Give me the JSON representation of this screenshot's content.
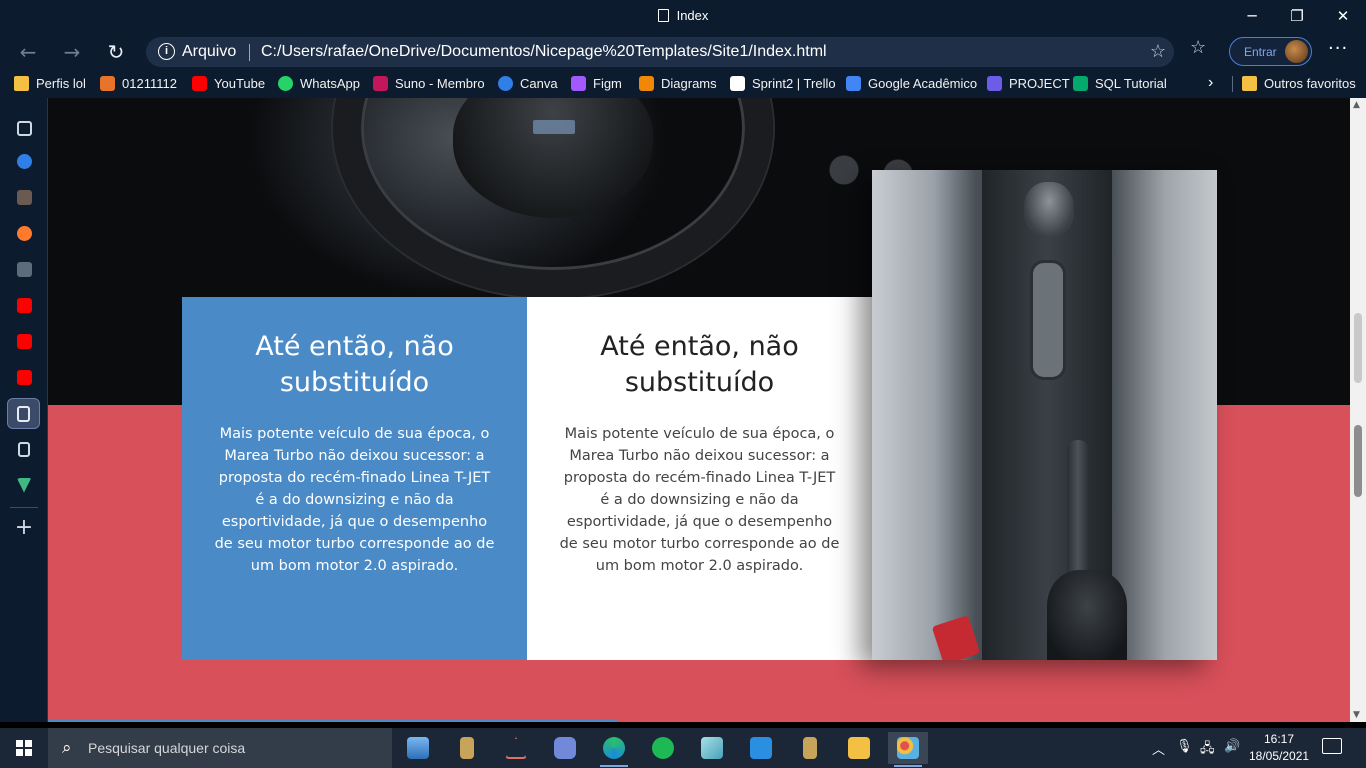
{
  "window": {
    "tab_title": "Index",
    "minimize": "─",
    "restore": "❐",
    "close": "✕"
  },
  "nav": {
    "back": "←",
    "forward": "→",
    "reload": "↻"
  },
  "address": {
    "site_label": "Arquivo",
    "url": "C:/Users/rafae/OneDrive/Documentos/Nicepage%20Templates/Site1/Index.html",
    "favorite_icon": "star-add-icon"
  },
  "profile": {
    "signin_label": "Entrar"
  },
  "bookmarks": {
    "items": [
      {
        "label": "Perfis lol",
        "color": "#f4c044"
      },
      {
        "label": "01211112",
        "color": "#e8742c"
      },
      {
        "label": "YouTube",
        "color": "#ff0000"
      },
      {
        "label": "WhatsApp",
        "color": "#25d366"
      },
      {
        "label": "Suno - Membro",
        "color": "#c2185b"
      },
      {
        "label": "Canva",
        "color": "#2f7fe6"
      },
      {
        "label": "Figm",
        "color": "#a259ff"
      },
      {
        "label": "Diagrams",
        "color": "#f08705"
      },
      {
        "label": "Sprint2 | Trello",
        "color": "#ffffff"
      },
      {
        "label": "Google Acadêmico",
        "color": "#4285f4"
      },
      {
        "label": "PROJECT",
        "color": "#6c5ce7"
      },
      {
        "label": "SQL Tutorial",
        "color": "#04aa6d"
      }
    ],
    "overflow": "›",
    "other_favorites": "Outros favoritos"
  },
  "cards": [
    {
      "title": "Até então, não substituído",
      "body": "Mais potente veículo de sua época, o Marea Turbo não deixou sucessor: a proposta do recém-finado Linea T-JET é a do downsizing e não da esportividade, já que o desempenho de seu motor turbo corresponde ao de um bom motor 2.0 aspirado.",
      "background": "#4a8ac6"
    },
    {
      "title": "Até então, não substituído",
      "body": "Mais potente veículo de sua época, o Marea Turbo não deixou sucessor: a proposta do recém-finado Linea T-JET é a do downsizing e não da esportividade, já que o desempenho de seu motor turbo corresponde ao de um bom motor 2.0 aspirado.",
      "background": "#ffffff"
    }
  ],
  "colors": {
    "band": "#d8505a",
    "accent_blue": "#4a8ac6"
  },
  "taskbar": {
    "search_placeholder": "Pesquisar qualquer coisa",
    "time": "16:17",
    "date": "18/05/2021"
  }
}
